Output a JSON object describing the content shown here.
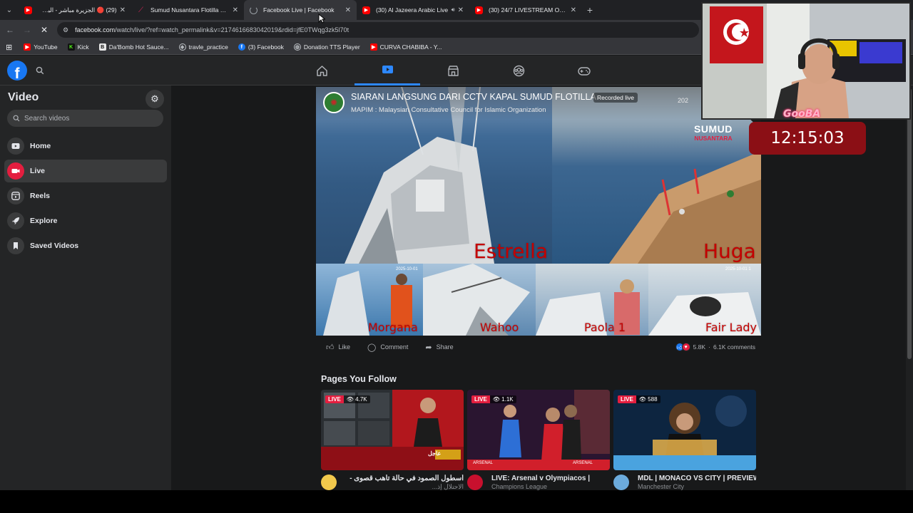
{
  "browser": {
    "tabs": [
      {
        "title": "(29) 🔴 الجزيرة مباشر - البث الح",
        "fav": "youtube",
        "active": false,
        "sound": false
      },
      {
        "title": "Sumud Nusantara Flotilla Track",
        "fav": "flotilla",
        "active": false,
        "sound": false
      },
      {
        "title": "Facebook Live | Facebook",
        "fav": "loading",
        "active": true,
        "sound": false
      },
      {
        "title": "(30) Al Jazeera Arabic Live",
        "fav": "youtube",
        "active": false,
        "sound": true
      },
      {
        "title": "(30) 24/7 LIVESTREAM OF GLO",
        "fav": "youtube",
        "active": false,
        "sound": false
      }
    ],
    "url_domain": "facebook.com",
    "url_path": "/watch/live/?ref=watch_permalink&v=2174616683042019&rdid=jfE0TWqg3zk5l70t",
    "bookmarks": [
      {
        "label": "YouTube",
        "icon": "youtube",
        "color": "#ff0000"
      },
      {
        "label": "Kick",
        "icon": "kick",
        "color": "#53fc18"
      },
      {
        "label": "Da'Bomb Hot Sauce...",
        "icon": "dabomb",
        "color": "#e8e8e8"
      },
      {
        "label": "travle_practice",
        "icon": "compass",
        "color": "#bdc1c6"
      },
      {
        "label": "(3) Facebook",
        "icon": "facebook",
        "color": "#1877f2"
      },
      {
        "label": "Donation TTS Player",
        "icon": "globe",
        "color": "#bdc1c6"
      },
      {
        "label": "CURVA CHABIBA - Y...",
        "icon": "youtube",
        "color": "#ff0000"
      }
    ]
  },
  "facebook": {
    "logo": "f",
    "nav": [
      "home-icon",
      "video-icon",
      "marketplace-icon",
      "groups-icon",
      "gaming-icon"
    ],
    "active_nav": 1
  },
  "sidebar": {
    "title": "Video",
    "search_placeholder": "Search videos",
    "items": [
      {
        "label": "Home",
        "icon": "play-icon"
      },
      {
        "label": "Live",
        "icon": "live-camera-icon"
      },
      {
        "label": "Reels",
        "icon": "reels-icon"
      },
      {
        "label": "Explore",
        "icon": "rocket-icon"
      },
      {
        "label": "Saved Videos",
        "icon": "bookmark-icon"
      }
    ],
    "active": 1
  },
  "video": {
    "title": "SIARAN LANGSUNG DARI CCTV KAPAL SUMUD FLOTILLA",
    "badge": "Recorded live",
    "subtitle": "MAPIM : Malaysian Consultative Council for Islamic Organization",
    "brand_top": "SUMUD",
    "brand_bottom": "NUSANTARA",
    "year_partial": "202",
    "boats": [
      "Estrella",
      "Huga",
      "Morgana",
      "Wahoo",
      "Paola 1",
      "Fair Lady"
    ],
    "stamps": [
      "2025-10-01",
      "2025-10-01 1"
    ]
  },
  "actions": {
    "like": "Like",
    "comment": "Comment",
    "share": "Share",
    "reaction_count": "5.8K",
    "comments_count": "6.1K comments"
  },
  "pages_you_follow": {
    "title": "Pages You Follow",
    "live_label": "LIVE",
    "cards": [
      {
        "views": "4.7K",
        "title": "أسطول الصمود في حالة تأهب قصوى -",
        "subtitle": "الاحتلال إذ..."
      },
      {
        "views": "1.1K",
        "title": "LIVE: Arsenal v Olympiacos |",
        "subtitle": "Champions League"
      },
      {
        "views": "588",
        "title": "MDL | MONACO VS CITY | PREVIEW",
        "subtitle": "Manchester City"
      }
    ],
    "card_texts": [
      "عاجل",
      "ARSENAL",
      "ARSENAL"
    ]
  },
  "overlay": {
    "clock": "12:15:03",
    "streamer": "GooBA"
  }
}
